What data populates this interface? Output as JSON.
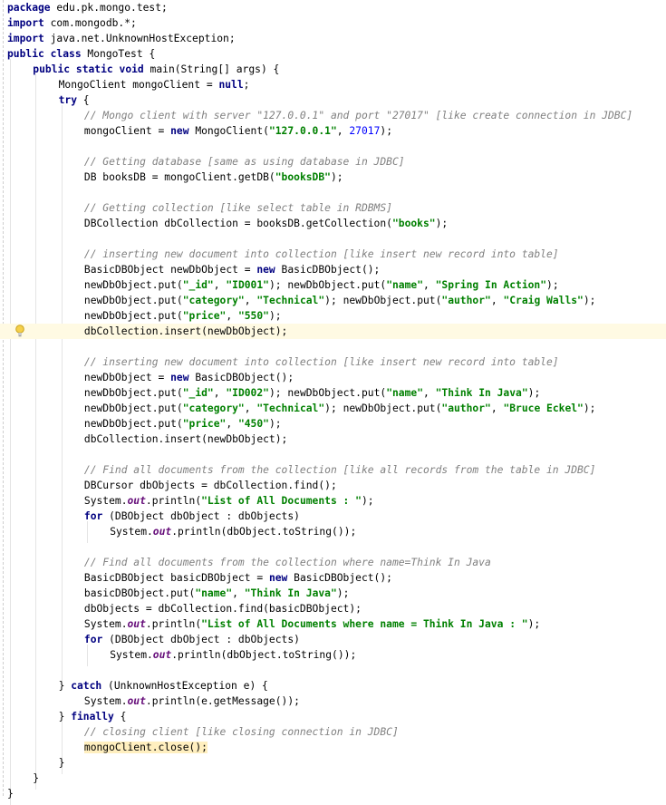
{
  "editor": {
    "language": "Java",
    "intention_bulb": "lightbulb-icon",
    "lines": [
      {
        "indent": 0,
        "tokens": [
          [
            "kw",
            "package"
          ],
          [
            "pln",
            " edu.pk.mongo.test;"
          ]
        ]
      },
      {
        "indent": 0,
        "tokens": [
          [
            "kw",
            "import"
          ],
          [
            "pln",
            " com.mongodb.*;"
          ]
        ]
      },
      {
        "indent": 0,
        "tokens": [
          [
            "kw",
            "import"
          ],
          [
            "pln",
            " java.net.UnknownHostException;"
          ]
        ]
      },
      {
        "indent": 0,
        "tokens": [
          [
            "kw",
            "public class"
          ],
          [
            "pln",
            " MongoTest {"
          ]
        ]
      },
      {
        "indent": 1,
        "tokens": [
          [
            "kw",
            "public static void"
          ],
          [
            "pln",
            " main(String[] args) {"
          ]
        ]
      },
      {
        "indent": 2,
        "tokens": [
          [
            "pln",
            "MongoClient mongoClient = "
          ],
          [
            "kw",
            "null"
          ],
          [
            "pln",
            ";"
          ]
        ]
      },
      {
        "indent": 2,
        "tokens": [
          [
            "kw",
            "try"
          ],
          [
            "pln",
            " {"
          ]
        ]
      },
      {
        "indent": 3,
        "tokens": [
          [
            "cmt",
            "// Mongo client with server \"127.0.0.1\" and port \"27017\" [like create connection in JDBC]"
          ]
        ]
      },
      {
        "indent": 3,
        "tokens": [
          [
            "pln",
            "mongoClient = "
          ],
          [
            "kw",
            "new"
          ],
          [
            "pln",
            " MongoClient("
          ],
          [
            "str",
            "\"127.0.0.1\""
          ],
          [
            "pln",
            ", "
          ],
          [
            "num",
            "27017"
          ],
          [
            "pln",
            ");"
          ]
        ]
      },
      {
        "indent": 0,
        "tokens": []
      },
      {
        "indent": 3,
        "tokens": [
          [
            "cmt",
            "// Getting database [same as using database in JDBC]"
          ]
        ]
      },
      {
        "indent": 3,
        "tokens": [
          [
            "pln",
            "DB booksDB = mongoClient.getDB("
          ],
          [
            "str",
            "\"booksDB\""
          ],
          [
            "pln",
            ");"
          ]
        ]
      },
      {
        "indent": 0,
        "tokens": []
      },
      {
        "indent": 3,
        "tokens": [
          [
            "cmt",
            "// Getting collection [like select table in RDBMS]"
          ]
        ]
      },
      {
        "indent": 3,
        "tokens": [
          [
            "pln",
            "DBCollection dbCollection = booksDB.getCollection("
          ],
          [
            "str",
            "\"books\""
          ],
          [
            "pln",
            ");"
          ]
        ]
      },
      {
        "indent": 0,
        "tokens": []
      },
      {
        "indent": 3,
        "tokens": [
          [
            "cmt",
            "// inserting new document into collection [like insert new record into table]"
          ]
        ]
      },
      {
        "indent": 3,
        "tokens": [
          [
            "pln",
            "BasicDBObject newDbObject = "
          ],
          [
            "kw",
            "new"
          ],
          [
            "pln",
            " BasicDBObject();"
          ]
        ]
      },
      {
        "indent": 3,
        "tokens": [
          [
            "pln",
            "newDbObject.put("
          ],
          [
            "str",
            "\"_id\""
          ],
          [
            "pln",
            ", "
          ],
          [
            "str",
            "\"ID001\""
          ],
          [
            "pln",
            "); newDbObject.put("
          ],
          [
            "str",
            "\"name\""
          ],
          [
            "pln",
            ", "
          ],
          [
            "str",
            "\"Spring In Action\""
          ],
          [
            "pln",
            ");"
          ]
        ]
      },
      {
        "indent": 3,
        "tokens": [
          [
            "pln",
            "newDbObject.put("
          ],
          [
            "str",
            "\"category\""
          ],
          [
            "pln",
            ", "
          ],
          [
            "str",
            "\"Technical\""
          ],
          [
            "pln",
            "); newDbObject.put("
          ],
          [
            "str",
            "\"author\""
          ],
          [
            "pln",
            ", "
          ],
          [
            "str",
            "\"Craig Walls\""
          ],
          [
            "pln",
            ");"
          ]
        ]
      },
      {
        "indent": 3,
        "tokens": [
          [
            "pln",
            "newDbObject.put("
          ],
          [
            "str",
            "\"price\""
          ],
          [
            "pln",
            ", "
          ],
          [
            "str",
            "\"550\""
          ],
          [
            "pln",
            ");"
          ]
        ]
      },
      {
        "indent": 3,
        "highlight": true,
        "bulb": true,
        "tokens": [
          [
            "pln",
            "dbCollection.insert(newDbObject);"
          ]
        ]
      },
      {
        "indent": 0,
        "tokens": []
      },
      {
        "indent": 3,
        "tokens": [
          [
            "cmt",
            "// inserting new document into collection [like insert new record into table]"
          ]
        ]
      },
      {
        "indent": 3,
        "tokens": [
          [
            "pln",
            "newDbObject = "
          ],
          [
            "kw",
            "new"
          ],
          [
            "pln",
            " BasicDBObject();"
          ]
        ]
      },
      {
        "indent": 3,
        "tokens": [
          [
            "pln",
            "newDbObject.put("
          ],
          [
            "str",
            "\"_id\""
          ],
          [
            "pln",
            ", "
          ],
          [
            "str",
            "\"ID002\""
          ],
          [
            "pln",
            "); newDbObject.put("
          ],
          [
            "str",
            "\"name\""
          ],
          [
            "pln",
            ", "
          ],
          [
            "str",
            "\"Think In Java\""
          ],
          [
            "pln",
            ");"
          ]
        ]
      },
      {
        "indent": 3,
        "tokens": [
          [
            "pln",
            "newDbObject.put("
          ],
          [
            "str",
            "\"category\""
          ],
          [
            "pln",
            ", "
          ],
          [
            "str",
            "\"Technical\""
          ],
          [
            "pln",
            "); newDbObject.put("
          ],
          [
            "str",
            "\"author\""
          ],
          [
            "pln",
            ", "
          ],
          [
            "str",
            "\"Bruce Eckel\""
          ],
          [
            "pln",
            ");"
          ]
        ]
      },
      {
        "indent": 3,
        "tokens": [
          [
            "pln",
            "newDbObject.put("
          ],
          [
            "str",
            "\"price\""
          ],
          [
            "pln",
            ", "
          ],
          [
            "str",
            "\"450\""
          ],
          [
            "pln",
            ");"
          ]
        ]
      },
      {
        "indent": 3,
        "tokens": [
          [
            "pln",
            "dbCollection.insert(newDbObject);"
          ]
        ]
      },
      {
        "indent": 0,
        "tokens": []
      },
      {
        "indent": 3,
        "tokens": [
          [
            "cmt",
            "// Find all documents from the collection [like all records from the table in JDBC]"
          ]
        ]
      },
      {
        "indent": 3,
        "tokens": [
          [
            "pln",
            "DBCursor dbObjects = dbCollection.find();"
          ]
        ]
      },
      {
        "indent": 3,
        "tokens": [
          [
            "pln",
            "System."
          ],
          [
            "fld",
            "out"
          ],
          [
            "pln",
            ".println("
          ],
          [
            "str",
            "\"List of All Documents : \""
          ],
          [
            "pln",
            ");"
          ]
        ]
      },
      {
        "indent": 3,
        "tokens": [
          [
            "kw",
            "for"
          ],
          [
            "pln",
            " (DBObject dbObject : dbObjects)"
          ]
        ]
      },
      {
        "indent": 4,
        "tokens": [
          [
            "pln",
            "System."
          ],
          [
            "fld",
            "out"
          ],
          [
            "pln",
            ".println(dbObject.toString());"
          ]
        ]
      },
      {
        "indent": 0,
        "tokens": []
      },
      {
        "indent": 3,
        "tokens": [
          [
            "cmt",
            "// Find all documents from the collection where name=Think In Java"
          ]
        ]
      },
      {
        "indent": 3,
        "tokens": [
          [
            "pln",
            "BasicDBObject basicDBObject = "
          ],
          [
            "kw",
            "new"
          ],
          [
            "pln",
            " BasicDBObject();"
          ]
        ]
      },
      {
        "indent": 3,
        "tokens": [
          [
            "pln",
            "basicDBObject.put("
          ],
          [
            "str",
            "\"name\""
          ],
          [
            "pln",
            ", "
          ],
          [
            "str",
            "\"Think In Java\""
          ],
          [
            "pln",
            ");"
          ]
        ]
      },
      {
        "indent": 3,
        "tokens": [
          [
            "pln",
            "dbObjects = dbCollection.find(basicDBObject);"
          ]
        ]
      },
      {
        "indent": 3,
        "tokens": [
          [
            "pln",
            "System."
          ],
          [
            "fld",
            "out"
          ],
          [
            "pln",
            ".println("
          ],
          [
            "str",
            "\"List of All Documents where name = Think In Java : \""
          ],
          [
            "pln",
            ");"
          ]
        ]
      },
      {
        "indent": 3,
        "tokens": [
          [
            "kw",
            "for"
          ],
          [
            "pln",
            " (DBObject dbObject : dbObjects)"
          ]
        ]
      },
      {
        "indent": 4,
        "tokens": [
          [
            "pln",
            "System."
          ],
          [
            "fld",
            "out"
          ],
          [
            "pln",
            ".println(dbObject.toString());"
          ]
        ]
      },
      {
        "indent": 0,
        "tokens": []
      },
      {
        "indent": 2,
        "tokens": [
          [
            "pln",
            "} "
          ],
          [
            "kw",
            "catch"
          ],
          [
            "pln",
            " (UnknownHostException e) {"
          ]
        ]
      },
      {
        "indent": 3,
        "tokens": [
          [
            "pln",
            "System."
          ],
          [
            "fld",
            "out"
          ],
          [
            "pln",
            ".println(e.getMessage());"
          ]
        ]
      },
      {
        "indent": 2,
        "tokens": [
          [
            "pln",
            "} "
          ],
          [
            "kw",
            "finally"
          ],
          [
            "pln",
            " {"
          ]
        ]
      },
      {
        "indent": 3,
        "tokens": [
          [
            "cmt",
            "// closing client [like closing connection in JDBC]"
          ]
        ]
      },
      {
        "indent": 3,
        "tokens": [
          [
            "hl",
            "mongoClient.close();"
          ]
        ]
      },
      {
        "indent": 2,
        "tokens": [
          [
            "pln",
            "}"
          ]
        ]
      },
      {
        "indent": 1,
        "tokens": [
          [
            "pln",
            "}"
          ]
        ]
      },
      {
        "indent": 0,
        "tokens": [
          [
            "pln",
            "}"
          ]
        ]
      }
    ]
  }
}
